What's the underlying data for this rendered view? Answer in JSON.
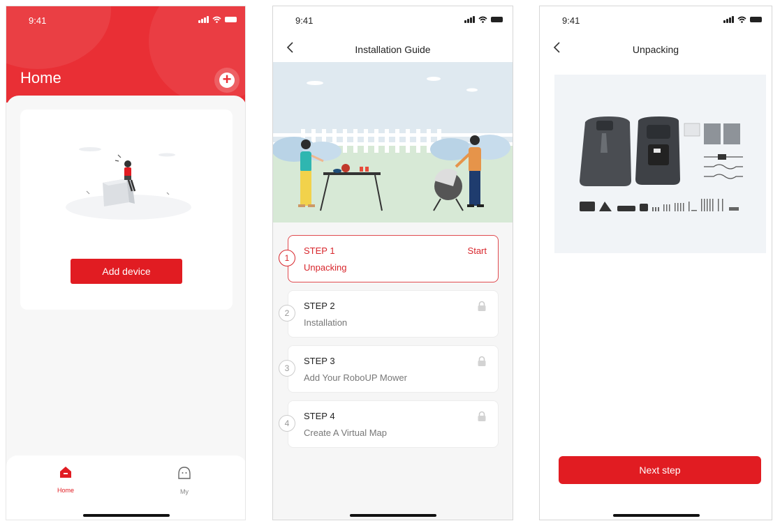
{
  "status": {
    "time": "9:41"
  },
  "home_screen": {
    "title": "Home",
    "add_device_label": "Add device",
    "tabs": [
      {
        "label": "Home"
      },
      {
        "label": "My"
      }
    ],
    "colors": {
      "accent": "#e92f35",
      "button": "#e11c22"
    }
  },
  "guide_screen": {
    "title": "Installation Guide",
    "steps": [
      {
        "number": "1",
        "title": "STEP 1",
        "desc": "Unpacking",
        "action": "Start",
        "state": "active"
      },
      {
        "number": "2",
        "title": "STEP 2",
        "desc": "Installation",
        "state": "locked"
      },
      {
        "number": "3",
        "title": "STEP 3",
        "desc": "Add Your RoboUP Mower",
        "state": "locked"
      },
      {
        "number": "4",
        "title": "STEP 4",
        "desc": "Create A Virtual Map",
        "state": "locked"
      }
    ]
  },
  "unpacking_screen": {
    "title": "Unpacking",
    "next_label": "Next step"
  },
  "icons": [
    "add-icon",
    "back-chevron-icon",
    "home-icon",
    "my-face-icon",
    "lock-icon",
    "signal-icon",
    "wifi-icon",
    "battery-icon"
  ]
}
